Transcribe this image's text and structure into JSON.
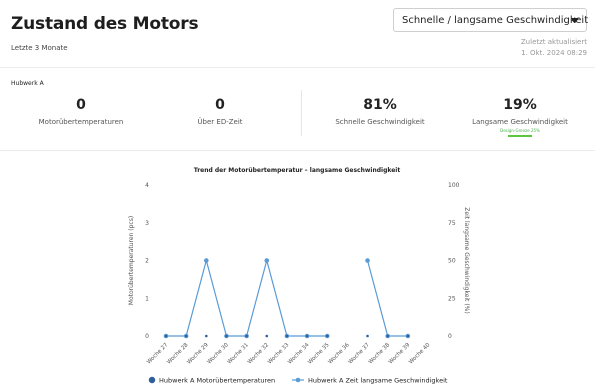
{
  "header": {
    "title": "Zustand des Motors",
    "period": "Letzte 3 Monate",
    "dropdown_label": "Schnelle / langsame Geschwindigkeit",
    "updated_label": "Zuletzt aktualisiert",
    "updated_value": "1. Okt. 2024 08:29"
  },
  "section": {
    "label": "Hubwerk A"
  },
  "kpis": [
    {
      "value": "0",
      "label": "Motorübertemperaturen"
    },
    {
      "value": "0",
      "label": "Über ED-Zeit"
    },
    {
      "value": "81%",
      "label": "Schnelle Geschwindigkeit"
    },
    {
      "value": "19%",
      "label": "Langsame Geschwindigkeit",
      "note": "Design-Grenze 25%"
    }
  ],
  "colors": {
    "series": "#5b9bd5",
    "series_dark": "#2d5f9e",
    "limit_bar": "#5bc73d"
  },
  "chart_data": {
    "type": "line",
    "title": "Trend der Motorübertemperatur – langsame Geschwindigkeit",
    "categories": [
      "Woche 27",
      "Woche 28",
      "Woche 29",
      "Woche 30",
      "Woche 31",
      "Woche 32",
      "Woche 33",
      "Woche 34",
      "Woche 35",
      "Woche 36",
      "Woche 37",
      "Woche 38",
      "Woche 39",
      "Woche 40"
    ],
    "ylabel_left": "Motorübertemperaturen (pcs)",
    "ylabel_right": "Zeit langsame Geschwindigkeit (%)",
    "ylim_left": [
      0,
      4
    ],
    "ylim_right": [
      0,
      100
    ],
    "yticks_left": [
      "0",
      "1",
      "2",
      "3",
      "4"
    ],
    "yticks_right": [
      "0",
      "25",
      "50",
      "75",
      "100"
    ],
    "grid": false,
    "legend_position": "bottom",
    "series": [
      {
        "name": "Hubwerk A Motorübertemperaturen",
        "axis": "left",
        "values": [
          0,
          0,
          0,
          0,
          0,
          0,
          0,
          0,
          0,
          null,
          0,
          0,
          0,
          null
        ]
      },
      {
        "name": "Hubwerk A Zeit langsame Geschwindigkeit",
        "axis": "right",
        "values": [
          0,
          0,
          50,
          0,
          0,
          50,
          0,
          0,
          0,
          null,
          50,
          0,
          0,
          null
        ]
      }
    ]
  }
}
